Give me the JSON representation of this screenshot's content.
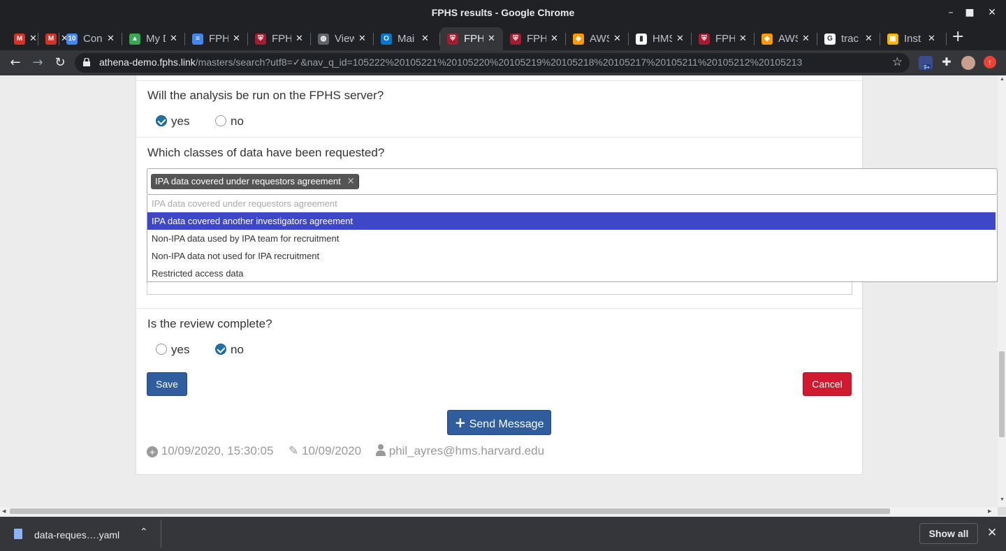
{
  "window": {
    "title": "FPHS results - Google Chrome",
    "minimize": "–",
    "maximize": "■",
    "close": "✕"
  },
  "tabs": [
    {
      "label": "",
      "icon": "gmail-icon",
      "color": "#d93025",
      "glyph": "M"
    },
    {
      "label": "",
      "icon": "gmail-icon",
      "color": "#d93025",
      "glyph": "M"
    },
    {
      "label": "Con",
      "icon": "calendar-icon",
      "color": "#4285f4",
      "glyph": "10"
    },
    {
      "label": "My D",
      "icon": "google-drive-icon",
      "color": "#34a853",
      "glyph": "▲"
    },
    {
      "label": "FPH",
      "icon": "docs-icon",
      "color": "#4285f4",
      "glyph": "≡"
    },
    {
      "label": "FPH",
      "icon": "harvard-shield-icon",
      "color": "#a51c30",
      "glyph": "⛨"
    },
    {
      "label": "View",
      "icon": "globe-icon",
      "color": "#5f6368",
      "glyph": "◍"
    },
    {
      "label": "Mai",
      "icon": "outlook-icon",
      "color": "#0078d4",
      "glyph": "O"
    },
    {
      "label": "FPH",
      "icon": "harvard-shield-icon",
      "color": "#a51c30",
      "glyph": "⛨",
      "active": true
    },
    {
      "label": "FPH",
      "icon": "harvard-shield-icon",
      "color": "#a51c30",
      "glyph": "⛨"
    },
    {
      "label": "AWS",
      "icon": "aws-icon",
      "color": "#f90",
      "glyph": "◆"
    },
    {
      "label": "HMS",
      "icon": "trello-icon",
      "color": "#ffffff",
      "glyph": "▮"
    },
    {
      "label": "FPH",
      "icon": "harvard-shield-icon",
      "color": "#a51c30",
      "glyph": "⛨"
    },
    {
      "label": "AWS",
      "icon": "aws-icon",
      "color": "#f90",
      "glyph": "◆"
    },
    {
      "label": "trac",
      "icon": "google-icon",
      "color": "#ffffff",
      "glyph": "G"
    },
    {
      "label": "Inst",
      "icon": "package-icon",
      "color": "#f4b400",
      "glyph": "▣"
    }
  ],
  "toolbar": {
    "back": "←",
    "forward": "→",
    "reload": "↻",
    "url_host": "athena-demo.fphs.link",
    "url_path": "/masters/search?utf8=✓&nav_q_id=105222%20105221%20105220%20105219%20105218%20105217%20105211%20105212%20105213",
    "star": "☆",
    "extension_badge": "9+"
  },
  "form": {
    "q_server": "Will the analysis be run on the FPHS server?",
    "q_server_yes": "yes",
    "q_server_no": "no",
    "q_classes": "Which classes of data have been requested?",
    "selected_chip": "IPA data covered under requestors agreement",
    "chip_remove": "×",
    "options": [
      {
        "label": "IPA data covered under requestors agreement",
        "state": "disabled"
      },
      {
        "label": "IPA data covered another investigators agreement",
        "state": "highlighted"
      },
      {
        "label": "Non-IPA data used by IPA team for recruitment",
        "state": "normal"
      },
      {
        "label": "Non-IPA data not used for IPA recruitment",
        "state": "normal"
      },
      {
        "label": "Restricted access data",
        "state": "normal"
      }
    ],
    "q_review": "Is the review complete?",
    "q_review_yes": "yes",
    "q_review_no": "no",
    "save": "Save",
    "cancel": "Cancel",
    "send_message": "Send Message",
    "created": "10/09/2020, 15:30:05",
    "updated": "10/09/2020",
    "user": "phil_ayres@hms.harvard.edu"
  },
  "downloads": {
    "file": "data-reques….yaml",
    "show_all": "Show all",
    "close": "✕",
    "chevron": "⌃"
  }
}
